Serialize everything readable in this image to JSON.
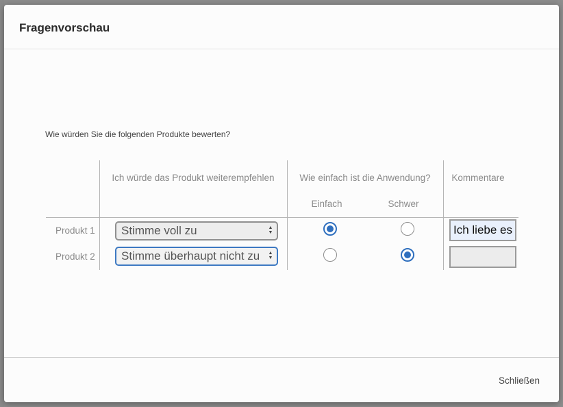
{
  "modal": {
    "title": "Fragenvorschau",
    "question": "Wie würden Sie die folgenden Produkte bewerten?",
    "close_label": "Schließen"
  },
  "matrix": {
    "columns": {
      "recommend": "Ich würde das Produkt weiterempfehlen",
      "ease": "Wie einfach ist die Anwendung?",
      "ease_easy": "Einfach",
      "ease_hard": "Schwer",
      "comments": "Kommentare"
    },
    "rows": [
      {
        "label": "Produkt 1",
        "recommend_value": "Stimme voll zu",
        "ease_selected": "Einfach",
        "comment": "Ich liebe es"
      },
      {
        "label": "Produkt 2",
        "recommend_value": "Stimme überhaupt nicht zu",
        "ease_selected": "Schwer",
        "comment": ""
      }
    ]
  },
  "colors": {
    "accent": "#2f6fbe",
    "overlay": "#7a7a7a"
  }
}
